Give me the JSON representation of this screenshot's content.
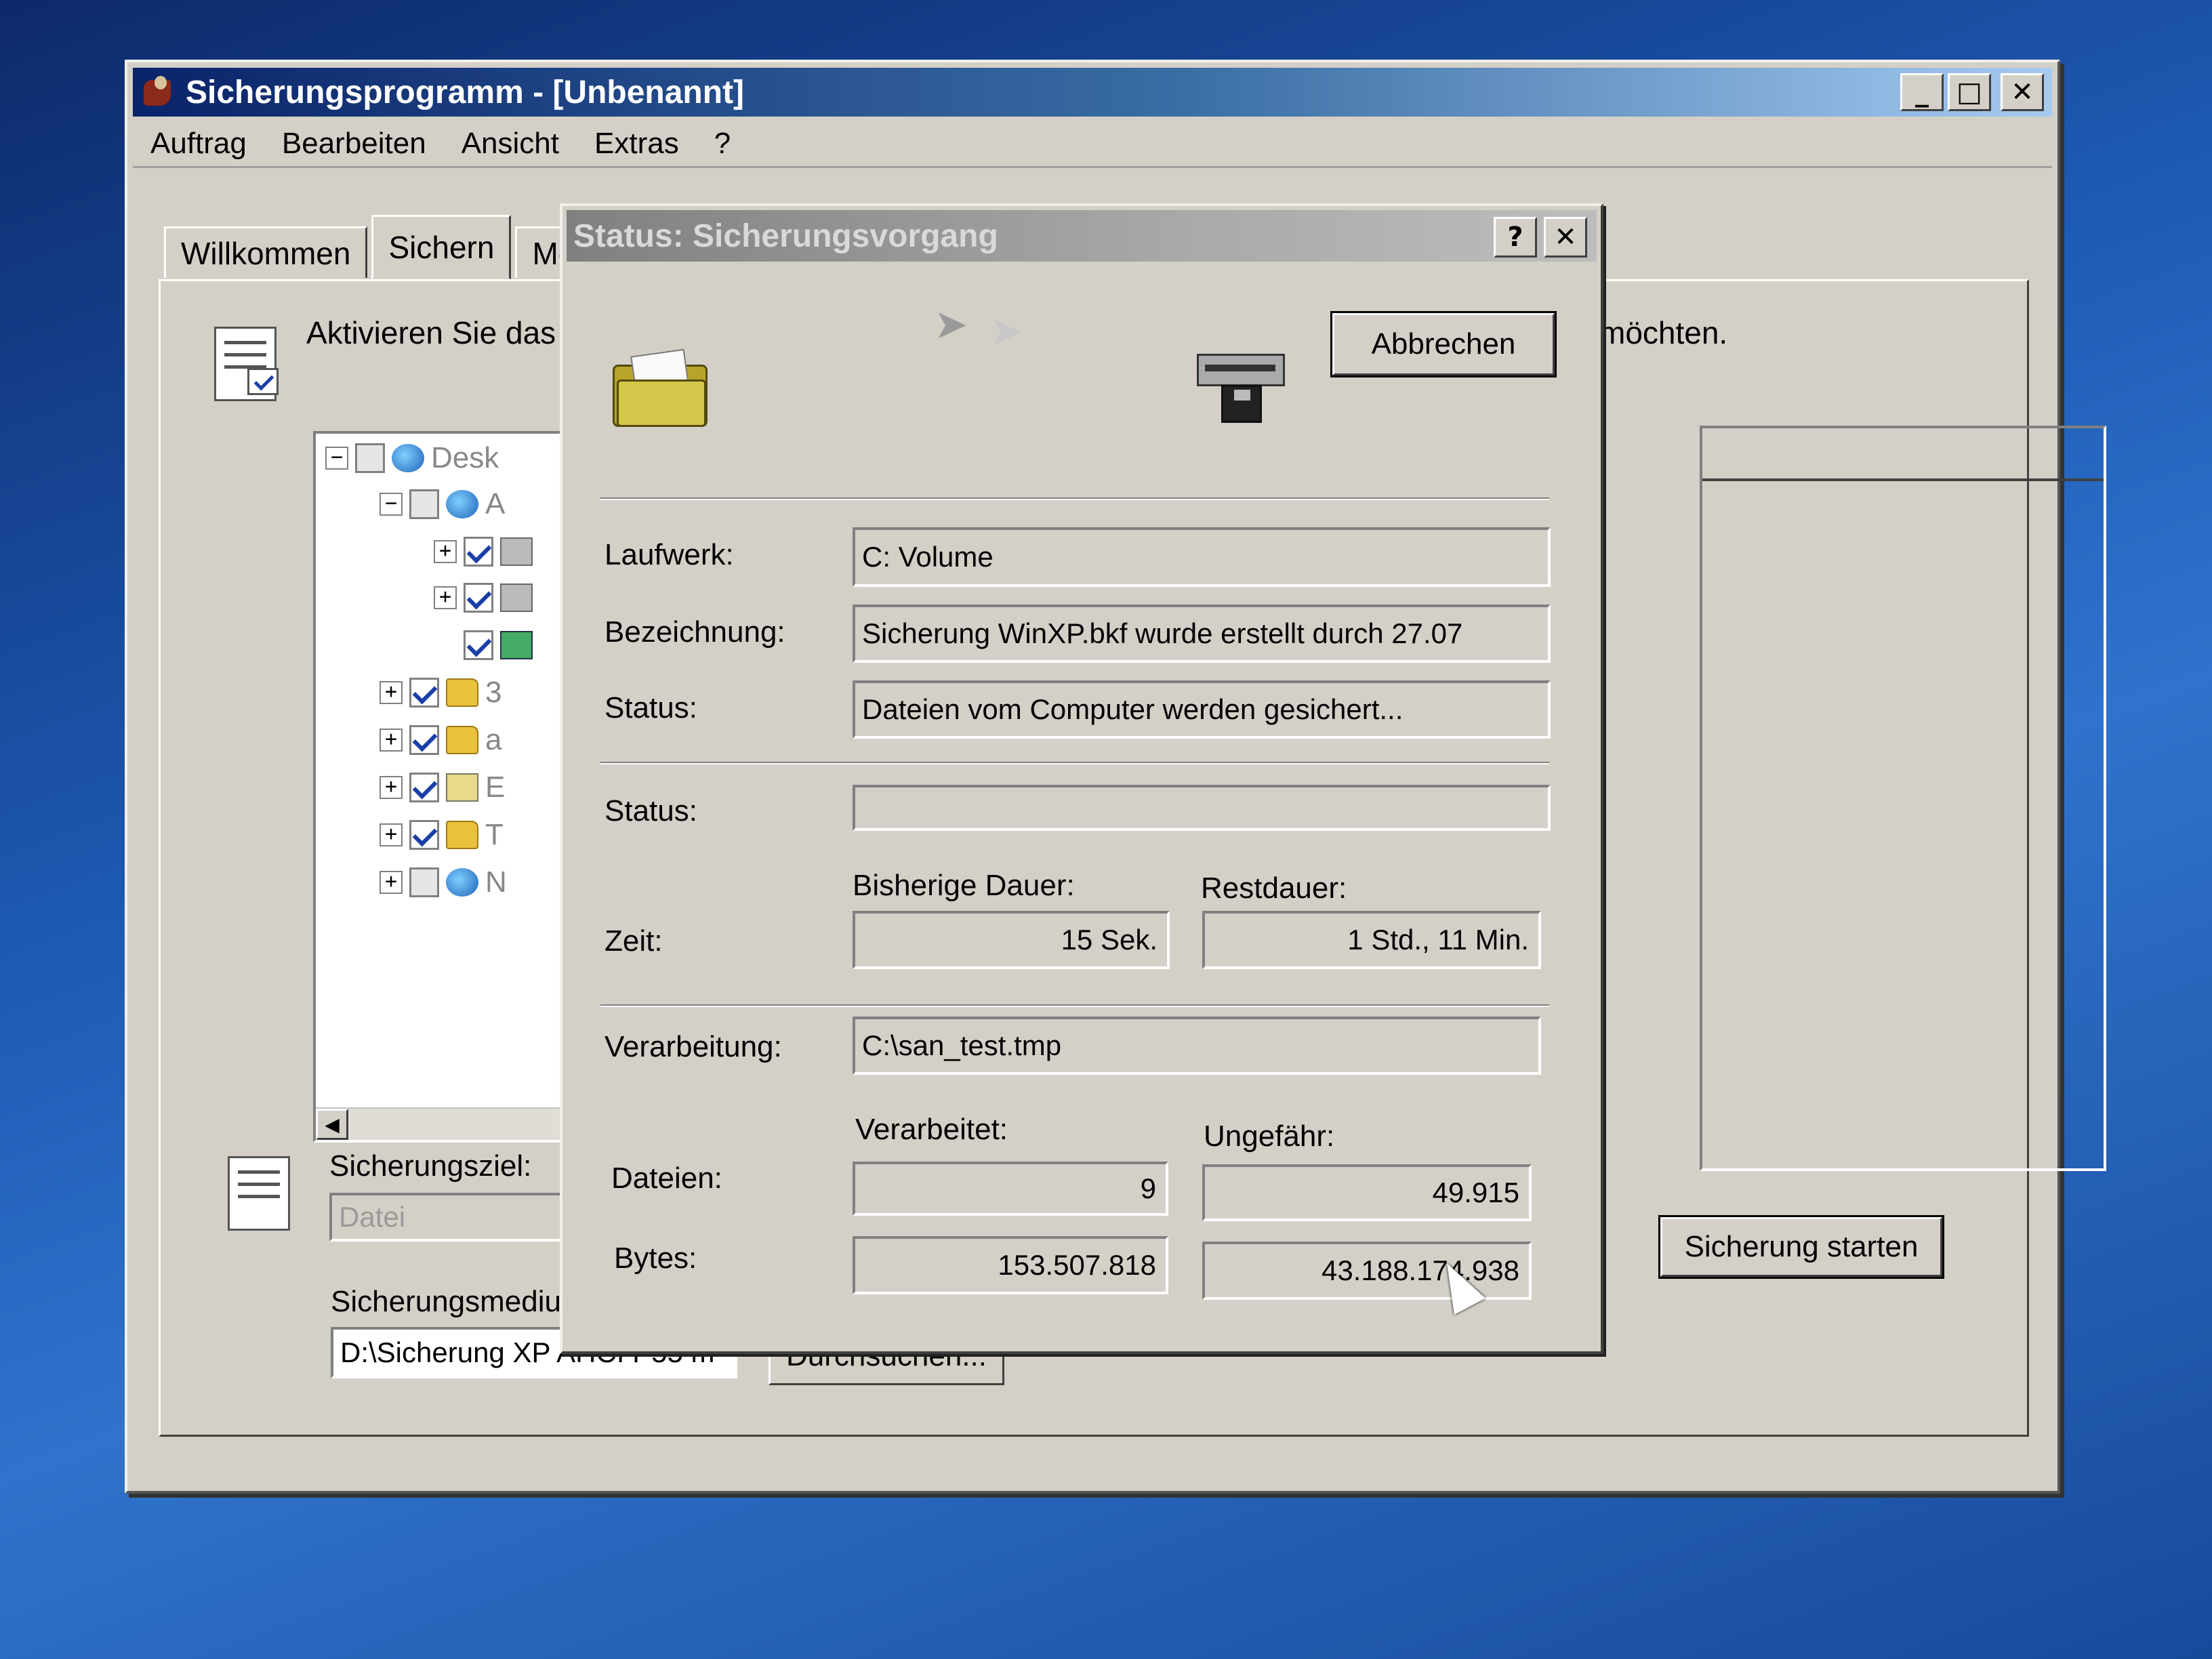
{
  "window": {
    "title": "Sicherungsprogramm - [Unbenannt]",
    "buttons": {
      "minimize": "_",
      "maximize": "□",
      "close": "✕"
    }
  },
  "menu": [
    "Auftrag",
    "Bearbeiten",
    "Ansicht",
    "Extras",
    "?"
  ],
  "tabs": [
    "Willkommen",
    "Sichern",
    "Me"
  ],
  "instruction": {
    "left": "Aktivieren Sie das",
    "right": "möchten."
  },
  "tree": {
    "items": [
      {
        "text": "Desk"
      },
      {
        "text": "A"
      },
      {
        "text": ""
      },
      {
        "text": ""
      },
      {
        "text": ""
      },
      {
        "text": "3"
      },
      {
        "text": "a"
      },
      {
        "text": "E"
      },
      {
        "text": "T"
      },
      {
        "text": "N"
      }
    ]
  },
  "bottom": {
    "ziel_label": "Sicherungsziel:",
    "ziel_value": "Datei",
    "medium_label": "Sicherungsmedium",
    "medium_value": "D:\\Sicherung XP AHCI P55 m",
    "browse_button": "Durchsuchen...",
    "start_button": "Sicherung starten"
  },
  "dialog": {
    "title": "Status: Sicherungsvorgang",
    "help_button": "?",
    "close_button": "✕",
    "cancel_button": "Abbrechen",
    "laufwerk_label": "Laufwerk:",
    "laufwerk_value": "C: Volume",
    "bezeichnung_label": "Bezeichnung:",
    "bezeichnung_value": "Sicherung WinXP.bkf wurde erstellt durch 27.07",
    "status_label": "Status:",
    "status_value": "Dateien vom Computer werden gesichert...",
    "progress_label": "Status:",
    "progress_fraction": 0.0,
    "zeit_label": "Zeit:",
    "bisherige_dauer_label": "Bisherige Dauer:",
    "bisherige_dauer_value": "15 Sek.",
    "restdauer_label": "Restdauer:",
    "restdauer_value": "1 Std., 11 Min.",
    "verarbeitung_label": "Verarbeitung:",
    "verarbeitung_value": "C:\\san_test.tmp",
    "verarbeitet_label": "Verarbeitet:",
    "ungefaehr_label": "Ungefähr:",
    "dateien_label": "Dateien:",
    "dateien_verarbeitet": "9",
    "dateien_ungefaehr": "49.915",
    "bytes_label": "Bytes:",
    "bytes_verarbeitet": "153.507.818",
    "bytes_ungefaehr": "43.188.174.938"
  }
}
